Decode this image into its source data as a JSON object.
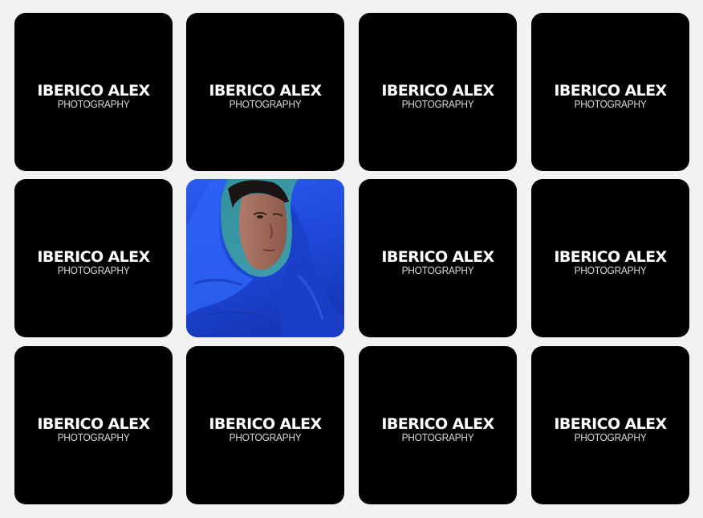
{
  "tiles": [
    {
      "type": "logo",
      "title": "IBERICO ALEX",
      "subtitle": "PHOTOGRAPHY"
    },
    {
      "type": "logo",
      "title": "IBERICO ALEX",
      "subtitle": "PHOTOGRAPHY"
    },
    {
      "type": "logo",
      "title": "IBERICO ALEX",
      "subtitle": "PHOTOGRAPHY"
    },
    {
      "type": "logo",
      "title": "IBERICO ALEX",
      "subtitle": "PHOTOGRAPHY"
    },
    {
      "type": "logo",
      "title": "IBERICO ALEX",
      "subtitle": "PHOTOGRAPHY"
    },
    {
      "type": "photo",
      "subject": "portrait-blue-hood"
    },
    {
      "type": "logo",
      "title": "IBERICO ALEX",
      "subtitle": "PHOTOGRAPHY"
    },
    {
      "type": "logo",
      "title": "IBERICO ALEX",
      "subtitle": "PHOTOGRAPHY"
    },
    {
      "type": "logo",
      "title": "IBERICO ALEX",
      "subtitle": "PHOTOGRAPHY"
    },
    {
      "type": "logo",
      "title": "IBERICO ALEX",
      "subtitle": "PHOTOGRAPHY"
    },
    {
      "type": "logo",
      "title": "IBERICO ALEX",
      "subtitle": "PHOTOGRAPHY"
    },
    {
      "type": "logo",
      "title": "IBERICO ALEX",
      "subtitle": "PHOTOGRAPHY"
    }
  ],
  "colors": {
    "page_background": "#f2f2f2",
    "tile_background": "#000000",
    "photo_backdrop": "#3a97a3",
    "photo_garment": "#1f4fe0"
  }
}
